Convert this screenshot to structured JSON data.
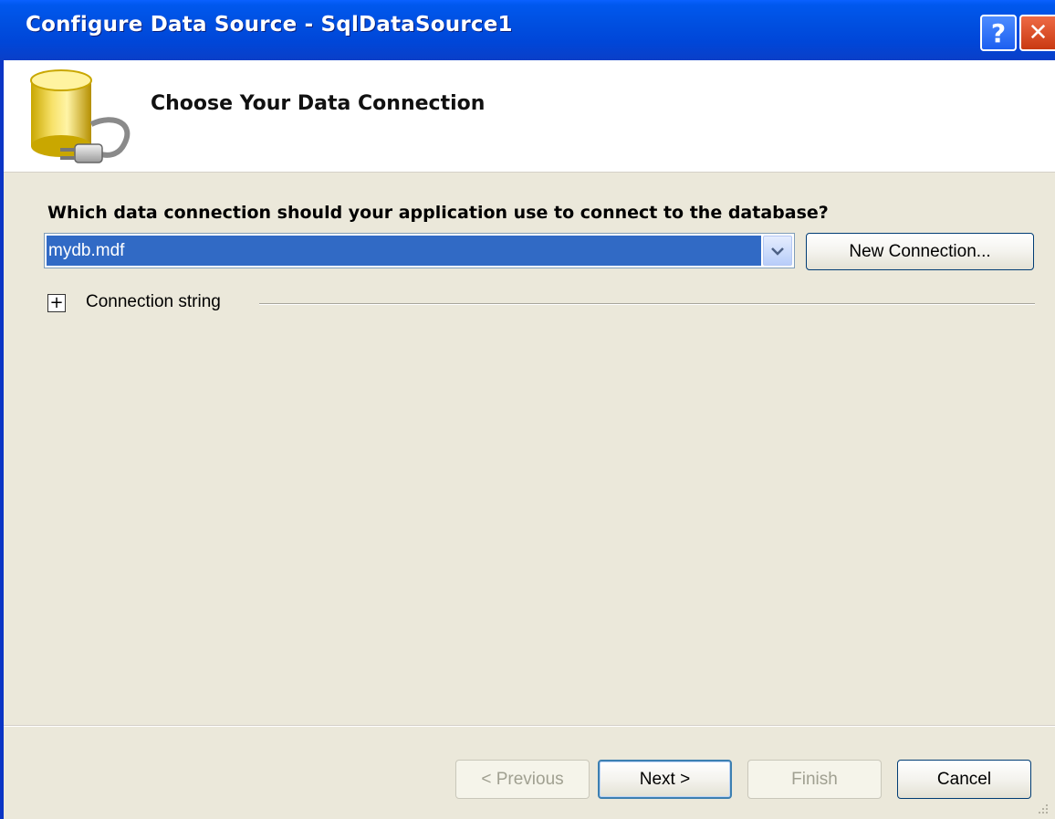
{
  "window": {
    "title": "Configure Data Source - SqlDataSource1",
    "help_glyph": "?",
    "close_glyph": "✕"
  },
  "header": {
    "title": "Choose Your Data Connection",
    "icon": "database-plug-icon"
  },
  "main": {
    "question": "Which data connection should your application use to connect to the database?",
    "connection_select": {
      "selected": "mydb.mdf"
    },
    "new_connection_label": "New Connection...",
    "connection_string_toggle": "+",
    "connection_string_label": "Connection string"
  },
  "footer": {
    "previous_label": "< Previous",
    "next_label": "Next >",
    "finish_label": "Finish",
    "cancel_label": "Cancel"
  },
  "colors": {
    "titlebar": "#0054e3",
    "content_bg": "#ebe8da",
    "selection": "#316ac5"
  }
}
